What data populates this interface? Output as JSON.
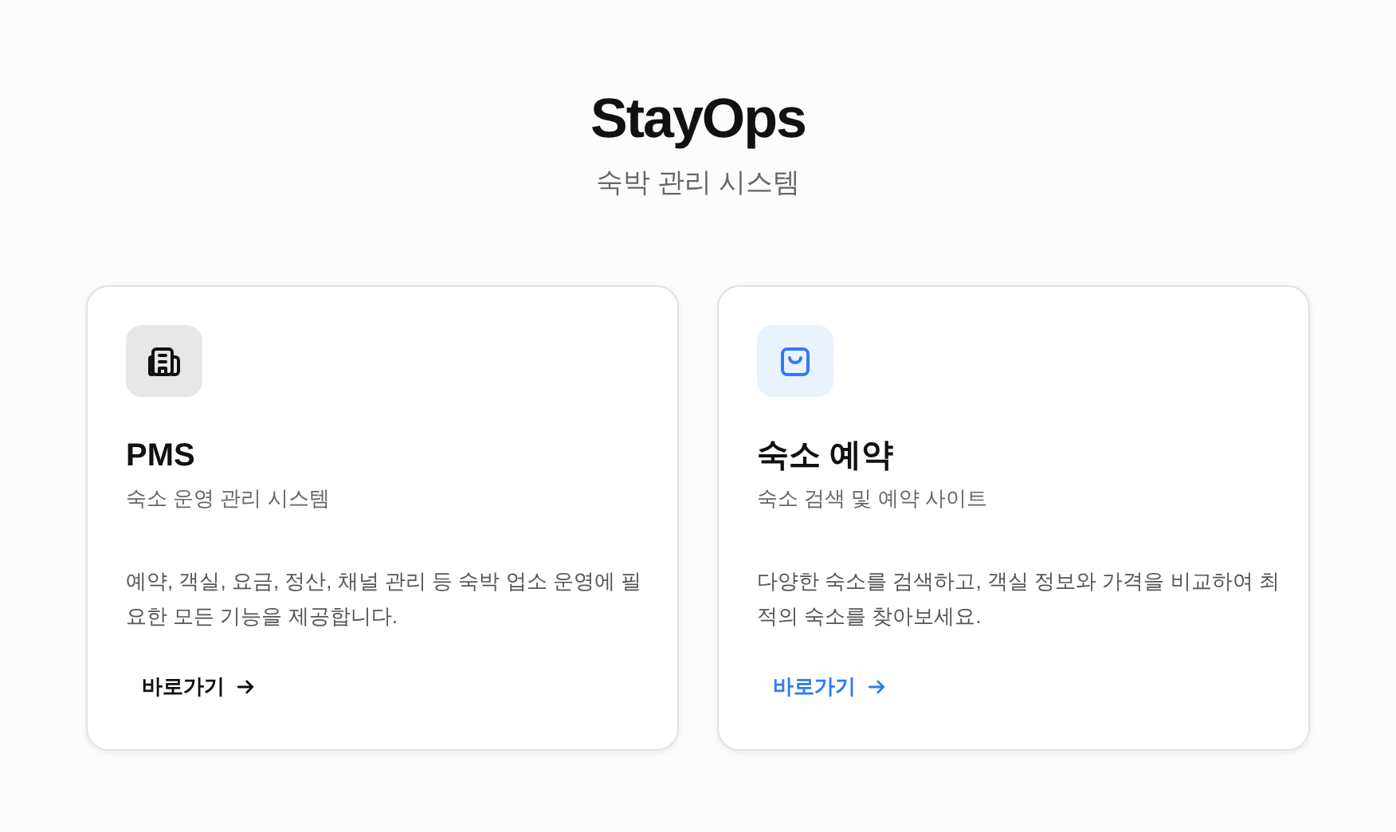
{
  "header": {
    "title": "StayOps",
    "subtitle": "숙박 관리 시스템"
  },
  "cards": [
    {
      "kind": "building",
      "color": "#111111",
      "title": "PMS",
      "subtitle": "숙소 운영 관리 시스템",
      "description": "예약, 객실, 요금, 정산, 채널 관리 등 숙박 업소 운영에 필요한 모든 기능을 제공합니다.",
      "link": "바로가기"
    },
    {
      "kind": "bag",
      "color": "#2f7cf6",
      "title": "숙소 예약",
      "subtitle": "숙소 검색 및 예약 사이트",
      "description": "다양한 숙소를 검색하고, 객실 정보와 가격을 비교하여 최적의 숙소를 찾아보세요.",
      "link": "바로가기"
    }
  ]
}
